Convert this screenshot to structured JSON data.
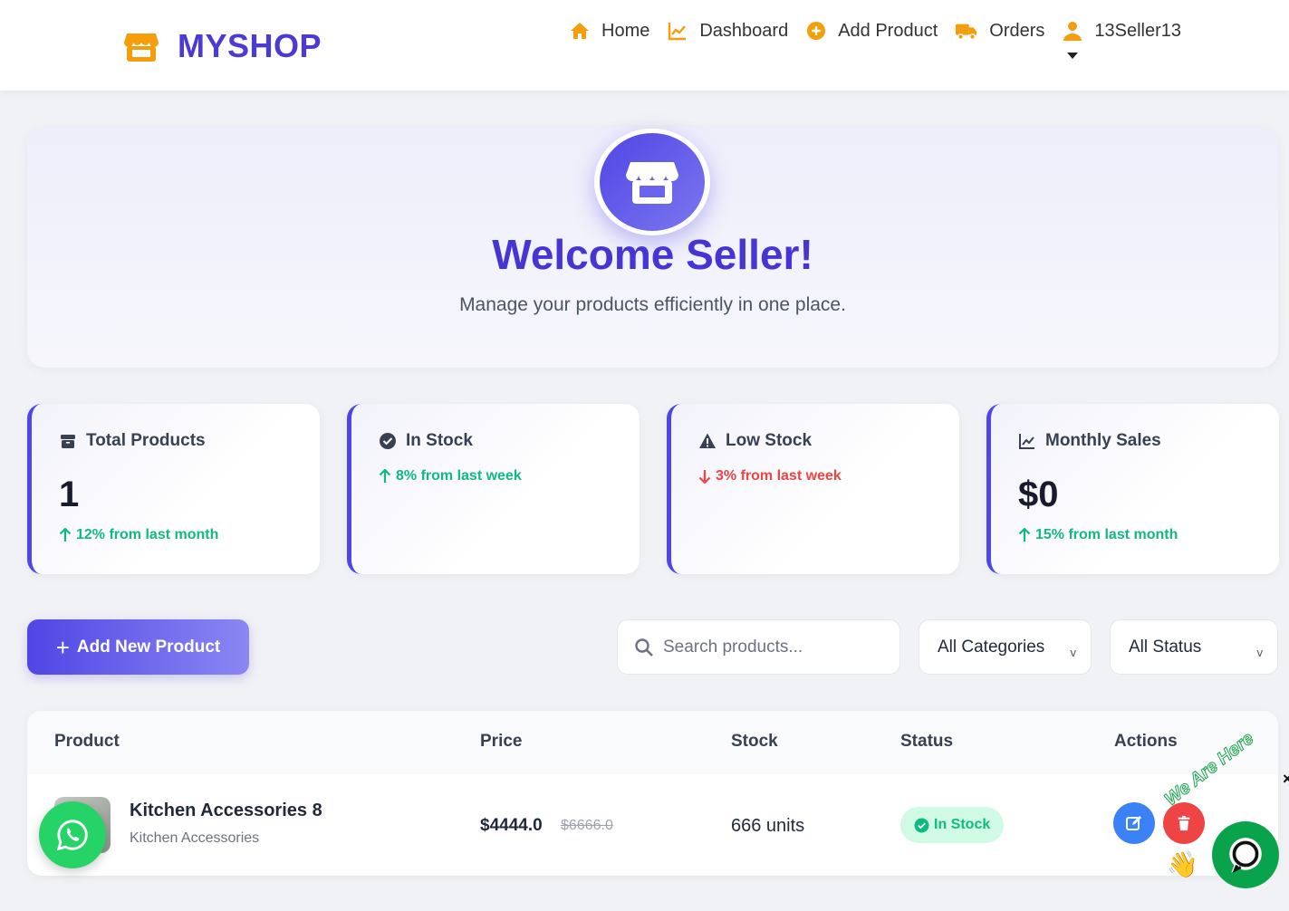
{
  "nav": {
    "brand": "MYSHOP",
    "items": [
      {
        "label": "Home",
        "icon": "home-icon"
      },
      {
        "label": "Dashboard",
        "icon": "chart-line-icon"
      },
      {
        "label": "Add Product",
        "icon": "plus-circle-icon"
      },
      {
        "label": "Orders",
        "icon": "truck-icon"
      }
    ],
    "user": {
      "label": "13Seller13",
      "icon": "user-icon"
    },
    "accent": "#f59e0b",
    "brand_color": "#4b3ad6"
  },
  "hero": {
    "title": "Welcome Seller!",
    "subtitle": "Manage your products efficiently in one place.",
    "icon": "store-icon"
  },
  "stats": [
    {
      "title": "Total Products",
      "icon": "box-icon",
      "value": "1",
      "trend": "12% from last month",
      "direction": "up"
    },
    {
      "title": "In Stock",
      "icon": "check-circle-icon",
      "value": "",
      "trend": "8% from last week",
      "direction": "up"
    },
    {
      "title": "Low Stock",
      "icon": "warning-icon",
      "value": "",
      "trend": "3% from last week",
      "direction": "down"
    },
    {
      "title": "Monthly Sales",
      "icon": "chart-line-icon",
      "value": "$0",
      "trend": "15% from last month",
      "direction": "up"
    }
  ],
  "controls": {
    "add_button": "Add New Product",
    "search_placeholder": "Search products...",
    "category_select": "All Categories",
    "status_select": "All Status",
    "chevron": "v"
  },
  "table": {
    "headers": [
      "Product",
      "Price",
      "Stock",
      "Status",
      "Actions"
    ],
    "rows": [
      {
        "name": "Kitchen Accessories 8",
        "category": "Kitchen Accessories",
        "price": "$4444.0",
        "old_price": "$6666.0",
        "stock": "666 units",
        "status": "In Stock"
      }
    ]
  },
  "widgets": {
    "chat_tagline": "We Are Here",
    "close": "×"
  }
}
